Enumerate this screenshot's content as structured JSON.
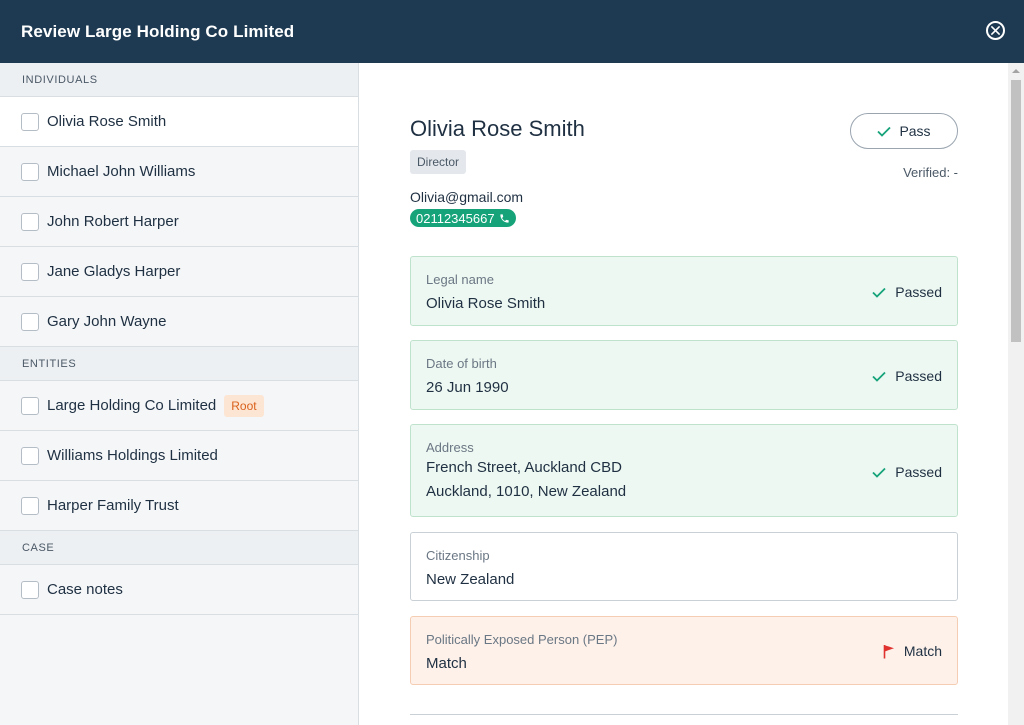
{
  "header": {
    "title": "Review Large Holding Co Limited"
  },
  "sidebar": {
    "individuals_heading": "INDIVIDUALS",
    "individuals": [
      {
        "label": "Olivia Rose Smith"
      },
      {
        "label": "Michael John Williams"
      },
      {
        "label": "John Robert Harper"
      },
      {
        "label": "Jane Gladys Harper"
      },
      {
        "label": "Gary John Wayne"
      }
    ],
    "entities_heading": "ENTITIES",
    "entities": [
      {
        "label": "Large Holding Co Limited",
        "badge": "Root"
      },
      {
        "label": "Williams Holdings Limited"
      },
      {
        "label": "Harper Family Trust"
      }
    ],
    "case_heading": "CASE",
    "case_items": [
      {
        "label": "Case notes"
      }
    ]
  },
  "person": {
    "name": "Olivia Rose Smith",
    "role": "Director",
    "email": "Olivia@gmail.com",
    "phone": "02112345667",
    "pass_label": "Pass",
    "verified": "Verified: -"
  },
  "checks": [
    {
      "label": "Legal name",
      "value": "Olivia Rose Smith",
      "status": "Passed"
    },
    {
      "label": "Date of birth",
      "value": "26 Jun 1990",
      "status": "Passed"
    },
    {
      "label": "Address",
      "value_line1": "French Street, Auckland CBD",
      "value_line2": "Auckland, 1010, New Zealand",
      "status": "Passed"
    },
    {
      "label": "Citizenship",
      "value": "New Zealand"
    },
    {
      "label": "Politically Exposed Person (PEP)",
      "value": "Match",
      "status": "Match"
    }
  ],
  "colors": {
    "header_bg": "#1e3a52",
    "pass_green": "#16a37a",
    "flag_red": "#e0332f",
    "root_badge": "#fde5d4"
  }
}
